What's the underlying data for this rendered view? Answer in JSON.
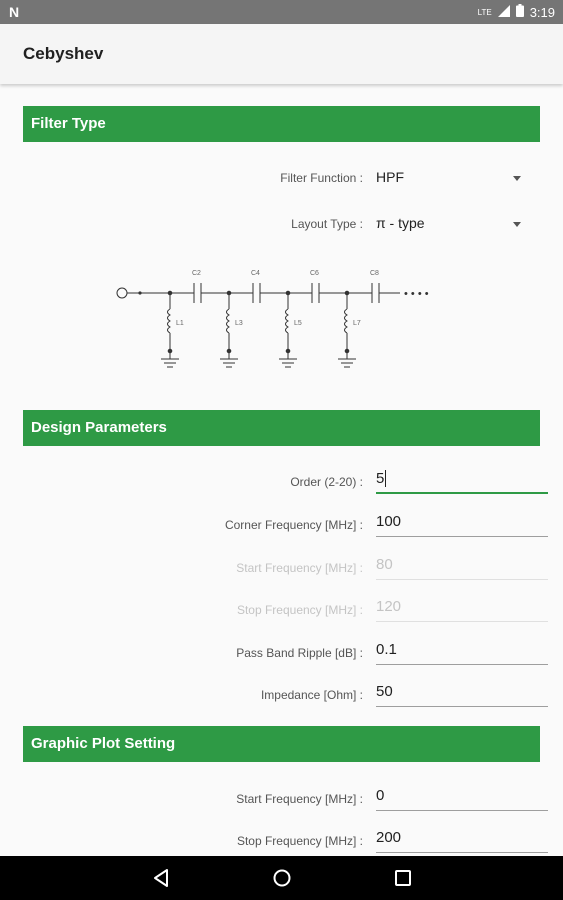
{
  "status_bar": {
    "left_icon": "notification-n-icon",
    "left_glyph": "N",
    "time": "3:19",
    "lte": "LTE",
    "icons": [
      "signal-icon",
      "battery-icon"
    ]
  },
  "app_bar": {
    "title": "Cebyshev"
  },
  "filter_type": {
    "header": "Filter Type",
    "filter_function": {
      "label": "Filter Function :",
      "value": "HPF"
    },
    "layout_type": {
      "label": "Layout Type :",
      "value": "π - type"
    },
    "diagram_labels": {
      "capacitors": [
        "C2",
        "C4",
        "C6",
        "C8"
      ],
      "inductors": [
        "L1",
        "L3",
        "L5",
        "L7"
      ],
      "ellipsis": "• • • •"
    }
  },
  "design_parameters": {
    "header": "Design Parameters",
    "fields": [
      {
        "label": "Order (2-20) :",
        "value": "5",
        "state": "focused"
      },
      {
        "label": "Corner Frequency [MHz] :",
        "value": "100",
        "state": "normal"
      },
      {
        "label": "Start Frequency [MHz] :",
        "value": "80",
        "state": "disabled"
      },
      {
        "label": "Stop Frequency [MHz] :",
        "value": "120",
        "state": "disabled"
      },
      {
        "label": "Pass Band Ripple [dB] :",
        "value": "0.1",
        "state": "normal"
      },
      {
        "label": "Impedance [Ohm] :",
        "value": "50",
        "state": "normal"
      }
    ]
  },
  "graphic_plot": {
    "header": "Graphic Plot Setting",
    "fields": [
      {
        "label": "Start Frequency [MHz] :",
        "value": "0"
      },
      {
        "label": "Stop Frequency [MHz] :",
        "value": "200"
      }
    ]
  },
  "nav_bar": {
    "icons": [
      "back-icon",
      "home-icon",
      "recents-icon"
    ]
  },
  "colors": {
    "accent": "#2e9a45",
    "status_bar": "#757575",
    "app_bar": "#f5f5f5"
  }
}
